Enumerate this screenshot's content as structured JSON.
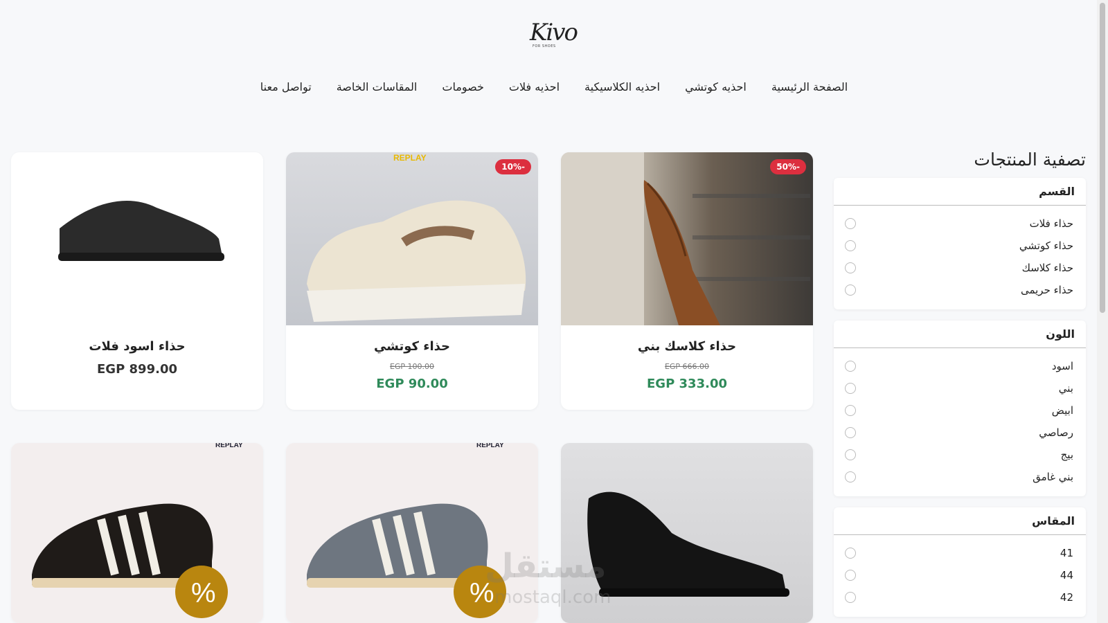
{
  "logo": {
    "text": "Kivo",
    "subtext": "FOR SHOES"
  },
  "nav": [
    "الصفحة الرئيسية",
    "احذيه كوتشي",
    "احذيه الكلاسيكية",
    "احذيه فلات",
    "خصومات",
    "المقاسات الخاصة",
    "تواصل معنا"
  ],
  "sidebar": {
    "title": "تصفية المنتجات",
    "groups": [
      {
        "title": "القسم",
        "options": [
          "حذاء فلات",
          "حذاء كوتشي",
          "حذاء كلاسك",
          "حذاء حريمى"
        ]
      },
      {
        "title": "اللون",
        "options": [
          "اسود",
          "بني",
          "ابيض",
          "رصاصي",
          "بيج",
          "بني غامق"
        ]
      },
      {
        "title": "المقاس",
        "options": [
          "41",
          "44",
          "42"
        ]
      }
    ]
  },
  "products": [
    {
      "name": "حذاء كلاسك بني",
      "old_price": "EGP 666.00",
      "price": "EGP 333.00",
      "badge": "50%-"
    },
    {
      "name": "حذاء كوتشي",
      "old_price": "EGP 100.00",
      "price": "EGP 90.00",
      "badge": "10%-",
      "image_text": "REPLAY"
    },
    {
      "name": "حذاء اسود فلات",
      "price": "EGP 899.00"
    },
    {
      "name": ""
    },
    {
      "name": "",
      "image_text": "REPLAY",
      "badge_icon": "%"
    },
    {
      "name": "",
      "image_text": "REPLAY",
      "badge_icon": "%"
    }
  ],
  "watermark": {
    "text": "مستقل",
    "sub": "mostaql.com"
  },
  "colors": {
    "sale_badge": "#dc2f3f",
    "price_green": "#2f8a5a",
    "background": "#f7f8fa"
  }
}
